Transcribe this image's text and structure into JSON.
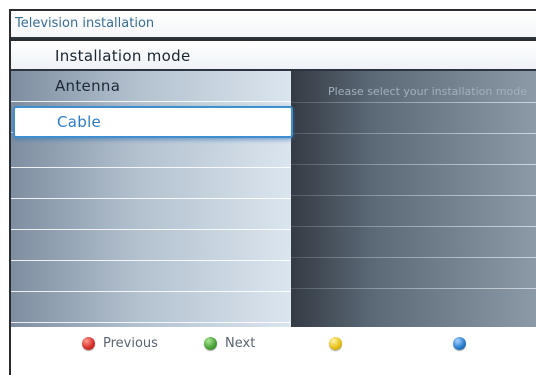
{
  "header": {
    "title": "Television installation"
  },
  "menu": {
    "title": "Installation mode",
    "items": [
      {
        "label": "Antenna"
      },
      {
        "label": "Cable"
      }
    ],
    "help_text": "Please select your installation mode"
  },
  "footer": {
    "buttons": [
      {
        "color_name": "red-button-icon",
        "color": "#d9342b",
        "label": "Previous"
      },
      {
        "color_name": "green-button-icon",
        "color": "#4aa43a",
        "label": "Next"
      },
      {
        "color_name": "yellow-button-icon",
        "color": "#e8c21c",
        "label": ""
      },
      {
        "color_name": "blue-button-icon",
        "color": "#2c7fd0",
        "label": ""
      }
    ]
  }
}
